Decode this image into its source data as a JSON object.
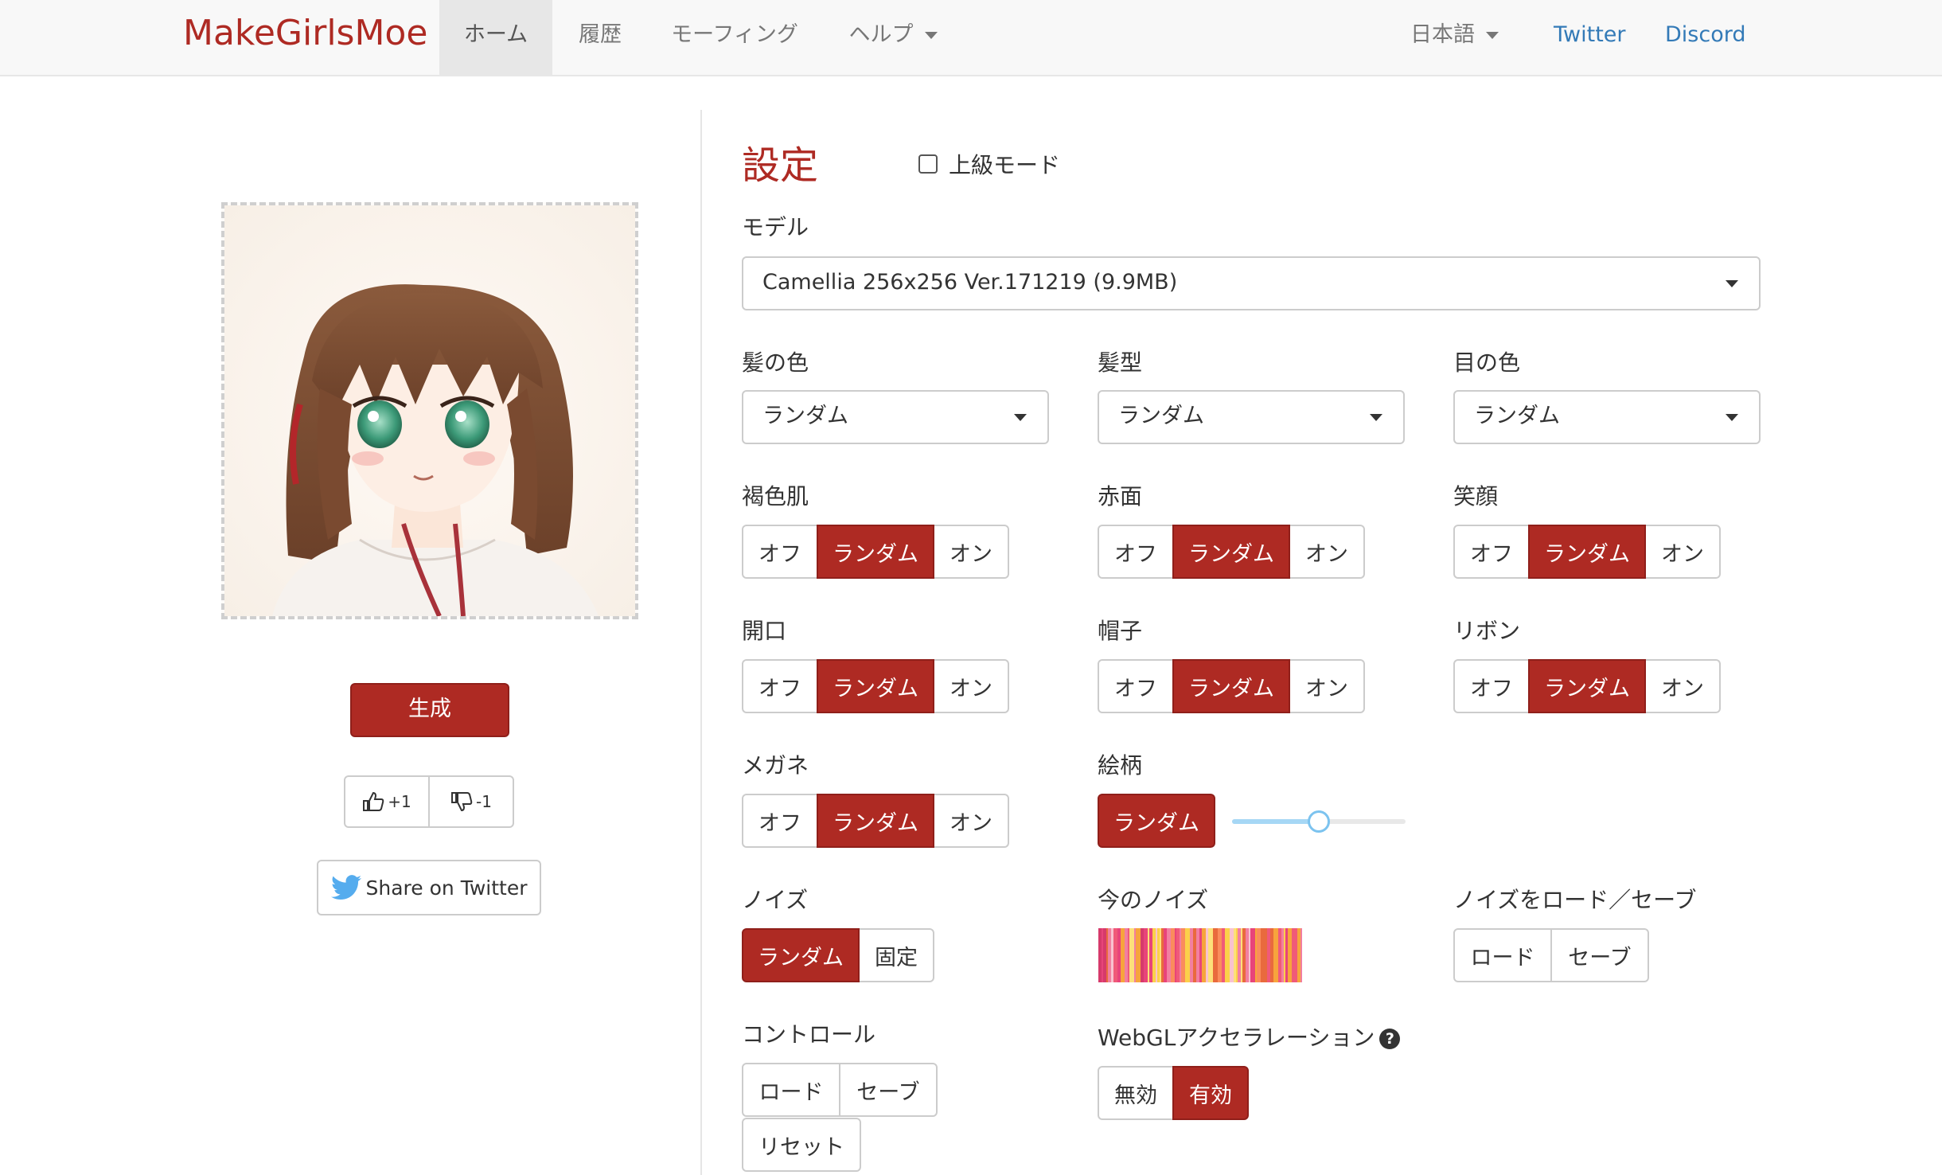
{
  "nav": {
    "brand": "MakeGirlsMoe",
    "items": [
      {
        "label": "ホーム",
        "active": true
      },
      {
        "label": "履歴"
      },
      {
        "label": "モーフィング"
      },
      {
        "label": "ヘルプ"
      }
    ],
    "language": "日本語",
    "twitter": "Twitter",
    "discord": "Discord"
  },
  "left": {
    "generate": "生成",
    "upvote": "+1",
    "downvote": "-1",
    "share": "Share on Twitter"
  },
  "settings": {
    "title": "設定",
    "advanced_mode": "上級モード",
    "model_label": "モデル",
    "model_value": "Camellia 256x256 Ver.171219 (9.9MB)",
    "hair_color_label": "髪の色",
    "hair_color_value": "ランダム",
    "hair_style_label": "髪型",
    "hair_style_value": "ランダム",
    "eye_color_label": "目の色",
    "eye_color_value": "ランダム",
    "off": "オフ",
    "random": "ランダム",
    "on": "オン",
    "dark_skin": "褐色肌",
    "blush": "赤面",
    "smile": "笑顔",
    "open_mouth": "開口",
    "hat": "帽子",
    "ribbon": "リボン",
    "glasses": "メガネ",
    "style": "絵柄",
    "style_value": 0.5,
    "noise": "ノイズ",
    "noise_fixed": "固定",
    "current_noise": "今のノイズ",
    "noise_load_save": "ノイズをロード／セーブ",
    "load": "ロード",
    "save": "セーブ",
    "control": "コントロール",
    "reset": "リセット",
    "webgl": "WebGLアクセラレーション",
    "disabled": "無効",
    "enabled": "有効"
  },
  "colors": {
    "accent": "#ae2a23",
    "link": "#337ab7"
  }
}
